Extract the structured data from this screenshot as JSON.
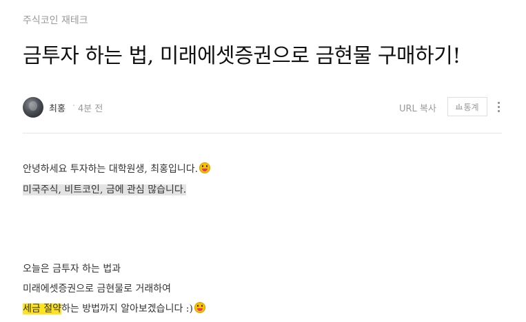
{
  "post": {
    "category": "주식코인 재테크",
    "title": "금투자 하는 법, 미래에셋증권으로 금현물 구매하기!"
  },
  "meta": {
    "author": "최홍",
    "separator": "·",
    "time": "4분 전",
    "url_copy": "URL 복사",
    "stats_label": "통계",
    "stats_icon": "bar-chart-icon"
  },
  "content": {
    "line1": "안녕하세요 투자하는 대학원생, 최홍입니다.",
    "line2": "미국주식, 비트코인, 금에 관심 많습니다.",
    "line3": "오늘은 금투자 하는 법과",
    "line4": "미래에셋증권으로 금현물로 거래하여",
    "line5_highlight": "세금 절약",
    "line5_rest": "하는 방법까지 알아보겠습니다 :)"
  },
  "colors": {
    "category": "#999999",
    "title": "#111111",
    "highlight_gray": "#e3e3e3",
    "highlight_yellow": "#ffe31e",
    "emoji": "#f5c000"
  }
}
